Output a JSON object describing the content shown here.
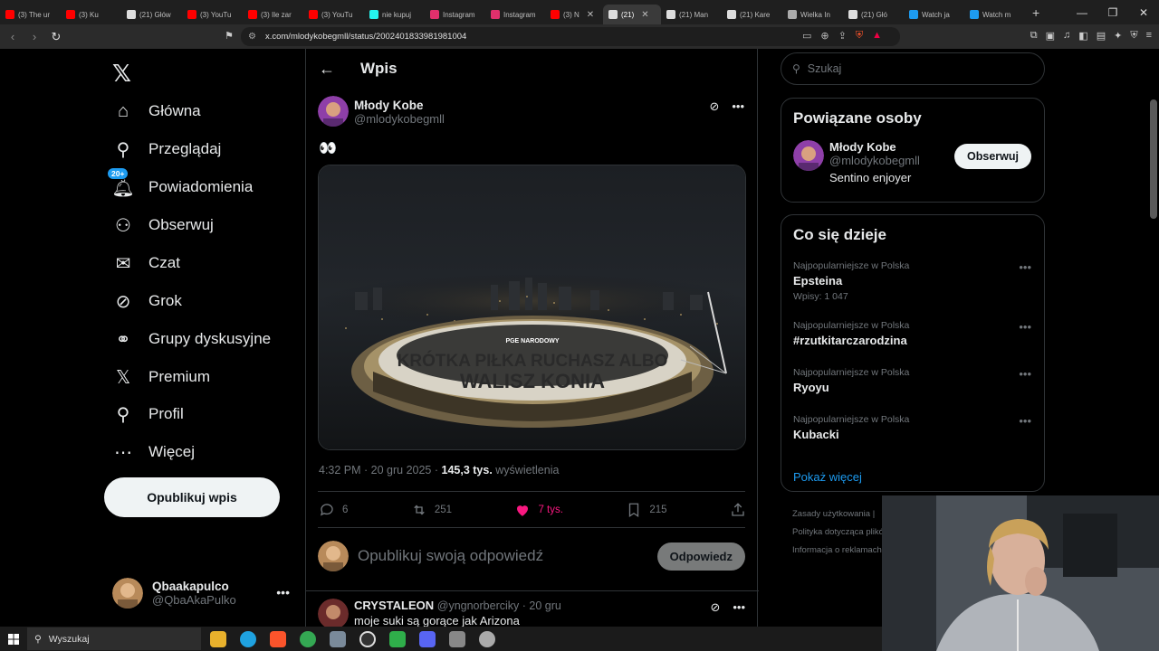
{
  "browser": {
    "tabs": [
      {
        "label": "(3) The ur",
        "color": "#ff0000"
      },
      {
        "label": "(3) Ku",
        "color": "#ff0000"
      },
      {
        "label": "(21) Głów",
        "color": "#dddddd"
      },
      {
        "label": "(3) YouTu",
        "color": "#ff0000"
      },
      {
        "label": "(3) Ile zar",
        "color": "#ff0000"
      },
      {
        "label": "(3) YouTu",
        "color": "#ff0000"
      },
      {
        "label": "nie kupuj",
        "color": "#25f4ee"
      },
      {
        "label": "Instagram",
        "color": "#e1306c"
      },
      {
        "label": "Instagram",
        "color": "#e1306c"
      },
      {
        "label": "(3) N",
        "color": "#ff0000"
      },
      {
        "label": "(21)",
        "color": "#dddddd"
      },
      {
        "label": "(21) Man",
        "color": "#dddddd"
      },
      {
        "label": "(21) Kare",
        "color": "#dddddd"
      },
      {
        "label": "Wielka In",
        "color": "#aaaaaa"
      },
      {
        "label": "(21) Głó",
        "color": "#dddddd"
      },
      {
        "label": "Watch ja",
        "color": "#1d9bf0"
      },
      {
        "label": "Watch m",
        "color": "#1d9bf0"
      }
    ],
    "url": "x.com/mlodykobegmll/status/2002401833981981004"
  },
  "sidebar": {
    "logo": "𝕏",
    "items": [
      {
        "label": "Główna",
        "icon": "home-icon",
        "glyph": "⌂"
      },
      {
        "label": "Przeglądaj",
        "icon": "search-icon",
        "glyph": "⚲"
      },
      {
        "label": "Powiadomienia",
        "icon": "bell-icon",
        "glyph": "🔔︎"
      },
      {
        "label": "Obserwuj",
        "icon": "add-person-icon",
        "glyph": "⚇"
      },
      {
        "label": "Czat",
        "icon": "mail-icon",
        "glyph": "✉"
      },
      {
        "label": "Grok",
        "icon": "grok-icon",
        "glyph": "⊘"
      },
      {
        "label": "Grupy dyskusyjne",
        "icon": "communities-icon",
        "glyph": "⚭"
      },
      {
        "label": "Premium",
        "icon": "x-premium-icon",
        "glyph": "𝕏"
      },
      {
        "label": "Profil",
        "icon": "profile-icon",
        "glyph": "⚲"
      },
      {
        "label": "Więcej",
        "icon": "more-icon",
        "glyph": "⋯"
      }
    ],
    "notif_badge": "20+",
    "post_button": "Opublikuj wpis",
    "account": {
      "name": "Qbaakapulco",
      "handle": "@QbaAkaPulko"
    }
  },
  "main": {
    "header_title": "Wpis",
    "author": {
      "name": "Młody Kobe",
      "handle": "@mlodykobegmll"
    },
    "text": "👀",
    "image_caption_lines": [
      "KRÓTKA PIŁKA RUCHASZ ALBO",
      "WALISZ KONIA"
    ],
    "image_logo": "PGE NARODOWY",
    "time": "4:32 PM · 20 gru 2025 · ",
    "views_count": "145,3 tys.",
    "views_label": " wyświetlenia",
    "actions": {
      "replies": "6",
      "reposts": "251",
      "likes": "7 tys.",
      "bookmarks": "215"
    },
    "reply_placeholder": "Opublikuj swoją odpowiedź",
    "reply_button": "Odpowiedz",
    "comment": {
      "name": "CRYSTALEON",
      "handle_time": "@yngnorberciky · 20 gru",
      "text": "moje suki są gorące jak Arizona"
    }
  },
  "right": {
    "search_placeholder": "Szukaj",
    "related_title": "Powiązane osoby",
    "related": {
      "name": "Młody Kobe",
      "handle": "@mlodykobegmll",
      "bio": "Sentino enjoyer",
      "follow": "Obserwuj"
    },
    "trends_title": "Co się dzieje",
    "trends": [
      {
        "context": "Najpopularniejsze w Polska",
        "name": "Epsteina",
        "count": "Wpisy: 1 047"
      },
      {
        "context": "Najpopularniejsze w Polska",
        "name": "#rzutkitarczarodzina",
        "count": ""
      },
      {
        "context": "Najpopularniejsze w Polska",
        "name": "Ryoyu",
        "count": ""
      },
      {
        "context": "Najpopularniejsze w Polska",
        "name": "Kubacki",
        "count": ""
      }
    ],
    "show_more": "Pokaż więcej",
    "footer": [
      "Zasady użytkowania  |",
      "Polityka dotycząca plików",
      "Informacja o reklamach"
    ]
  },
  "taskbar": {
    "search": "Wyszukaj"
  },
  "colors": {
    "accent": "#1d9bf0",
    "like": "#f91880",
    "border": "#2f3336",
    "muted": "#71767b"
  }
}
